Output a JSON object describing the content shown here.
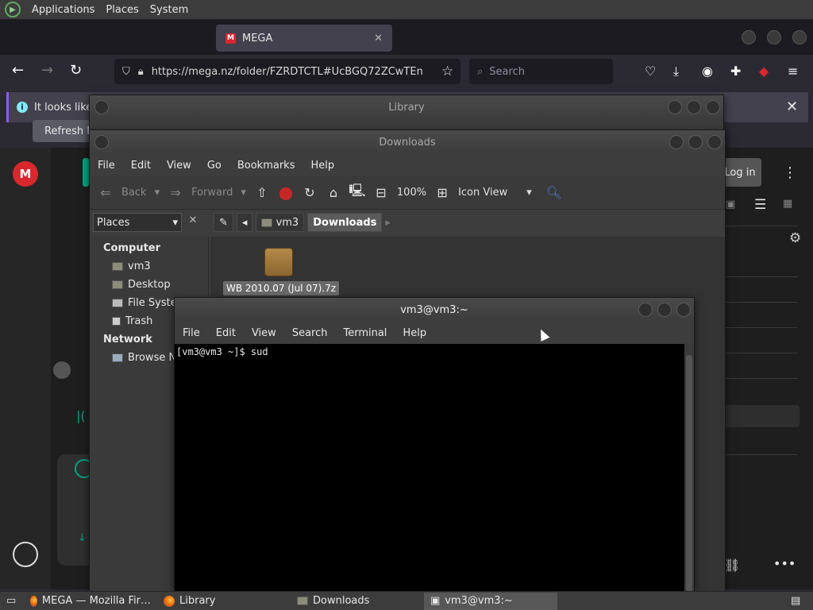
{
  "top_panel": {
    "menus": [
      "Applications",
      "Places",
      "System"
    ]
  },
  "firefox": {
    "tab_title": "MEGA",
    "url": "https://mega.nz/folder/FZRDTCTL#UcBGQ72ZCwTEn",
    "search_placeholder": "Search",
    "notification_text": "It looks like",
    "refresh_label": "Refresh Fi",
    "mega_logo": "M",
    "login_label": "Log in"
  },
  "library": {
    "title": "Library"
  },
  "downloads": {
    "title": "Downloads",
    "menus": [
      "File",
      "Edit",
      "View",
      "Go",
      "Bookmarks",
      "Help"
    ],
    "toolbar": {
      "back": "Back",
      "forward": "Forward",
      "zoom": "100%",
      "view": "Icon View"
    },
    "places_combo": "Places",
    "breadcrumbs": [
      "vm3",
      "Downloads"
    ],
    "sidebar": {
      "computer_header": "Computer",
      "computer_items": [
        "vm3",
        "Desktop",
        "File Syste",
        "Trash"
      ],
      "network_header": "Network",
      "network_items": [
        "Browse N"
      ]
    },
    "file_label": "WB 2010.07 (Jul 07).7z"
  },
  "terminal": {
    "title": "vm3@vm3:~",
    "menus": [
      "File",
      "Edit",
      "View",
      "Search",
      "Terminal",
      "Help"
    ],
    "prompt_line": "[vm3@vm3 ~]$ sud"
  },
  "taskbar": {
    "items": [
      "MEGA — Mozilla Fir…",
      "Library",
      "Downloads",
      "vm3@vm3:~"
    ]
  }
}
